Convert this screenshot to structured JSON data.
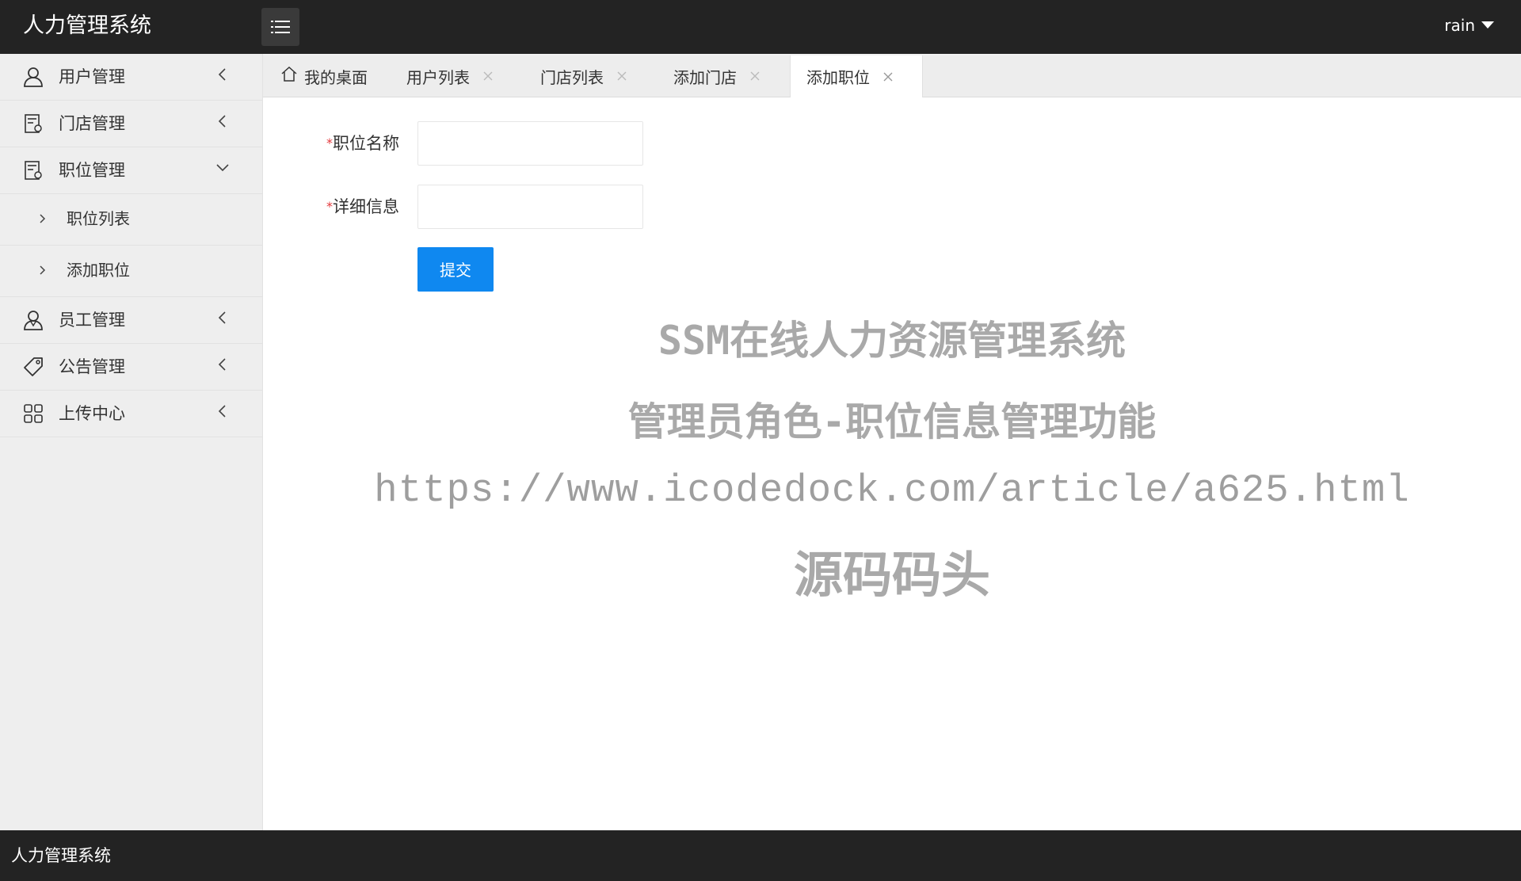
{
  "header": {
    "title": "人力管理系统",
    "user": "rain"
  },
  "sidebar": {
    "items": [
      {
        "label": "用户管理",
        "icon": "user-icon",
        "expanded": false
      },
      {
        "label": "门店管理",
        "icon": "store-icon",
        "expanded": false
      },
      {
        "label": "职位管理",
        "icon": "position-icon",
        "expanded": true,
        "children": [
          {
            "label": "职位列表"
          },
          {
            "label": "添加职位"
          }
        ]
      },
      {
        "label": "员工管理",
        "icon": "staff-icon",
        "expanded": false
      },
      {
        "label": "公告管理",
        "icon": "tag-icon",
        "expanded": false
      },
      {
        "label": "上传中心",
        "icon": "grid-icon",
        "expanded": false
      }
    ]
  },
  "tabs": [
    {
      "label": "我的桌面",
      "icon": "home-icon",
      "closable": false
    },
    {
      "label": "用户列表",
      "closable": true
    },
    {
      "label": "门店列表",
      "closable": true
    },
    {
      "label": "添加门店",
      "closable": true
    },
    {
      "label": "添加职位",
      "closable": true,
      "active": true
    }
  ],
  "form": {
    "required_mark": "*",
    "fields": [
      {
        "label": "职位名称",
        "value": ""
      },
      {
        "label": "详细信息",
        "value": ""
      }
    ],
    "submit_label": "提交"
  },
  "watermark": {
    "line1": "SSM在线人力资源管理系统",
    "line2": "管理员角色-职位信息管理功能",
    "line3": "https://www.icodedock.com/article/a625.html",
    "line4": "源码码头"
  },
  "footer": {
    "text": "人力管理系统"
  },
  "colors": {
    "header_bg": "#232323",
    "primary_button": "#0f88f0",
    "required": "#e4393c",
    "watermark": "#a9a9a9"
  }
}
